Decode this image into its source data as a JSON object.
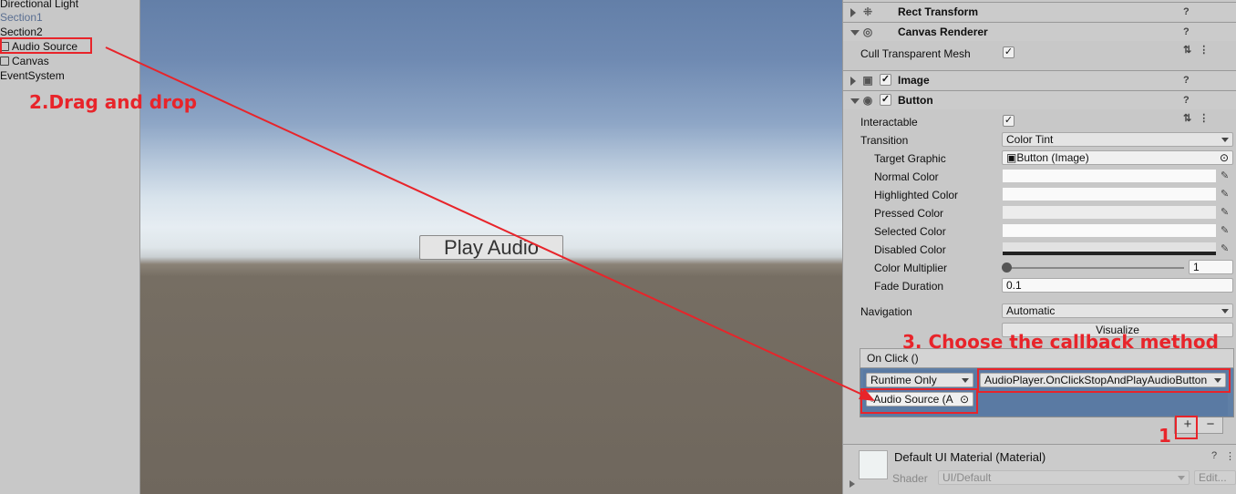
{
  "hierarchy": {
    "items": [
      {
        "label": "Directional Light",
        "dim": false,
        "icon": false
      },
      {
        "label": "Section1",
        "dim": true,
        "icon": false
      },
      {
        "label": "Section2",
        "dim": false,
        "icon": false
      },
      {
        "label": "Audio Source",
        "dim": false,
        "icon": true
      },
      {
        "label": "Canvas",
        "dim": false,
        "icon": true
      },
      {
        "label": "EventSystem",
        "dim": false,
        "icon": false
      }
    ]
  },
  "scene": {
    "button_label": "Play Audio"
  },
  "inspector": {
    "rect_transform": "Rect Transform",
    "canvas_renderer": "Canvas Renderer",
    "cull_label": "Cull Transparent Mesh",
    "image": "Image",
    "button": "Button",
    "interactable_label": "Interactable",
    "transition_label": "Transition",
    "transition_value": "Color Tint",
    "target_graphic_label": "Target Graphic",
    "target_graphic_value": "Button (Image)",
    "normal_color_label": "Normal Color",
    "highlighted_color_label": "Highlighted Color",
    "pressed_color_label": "Pressed Color",
    "selected_color_label": "Selected Color",
    "disabled_color_label": "Disabled Color",
    "color_multiplier_label": "Color Multiplier",
    "color_multiplier_value": "1",
    "fade_duration_label": "Fade Duration",
    "fade_duration_value": "0.1",
    "navigation_label": "Navigation",
    "navigation_value": "Automatic",
    "visualize_label": "Visualize",
    "onclick_title": "On Click ()",
    "runtime_value": "Runtime Only",
    "function_value": "AudioPlayer.OnClickStopAndPlayAudioButton",
    "object_value": "Audio Source (A",
    "plus": "+",
    "minus": "−",
    "material_name": "Default UI Material (Material)",
    "shader_label": "Shader",
    "shader_value": "UI/Default",
    "edit_label": "Edit..."
  },
  "annotations": {
    "step1": "1",
    "step2": "2.Drag and drop",
    "step3": "3. Choose the callback method"
  },
  "colors": {
    "annotation_red": "#e8242a",
    "onclick_blue": "#5f7fa6"
  }
}
